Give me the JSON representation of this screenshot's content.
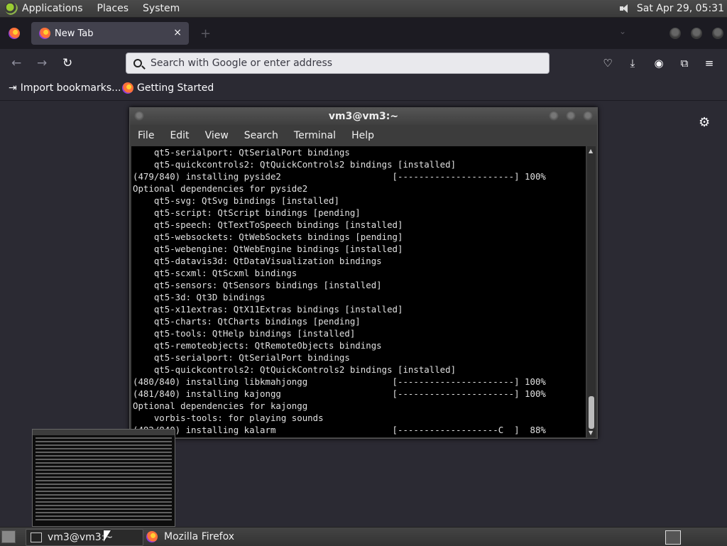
{
  "top_panel": {
    "menus": [
      "Applications",
      "Places",
      "System"
    ],
    "clock": "Sat Apr 29, 05:31"
  },
  "firefox": {
    "tab_title": "New Tab",
    "tab_close": "×",
    "new_tab": "+",
    "url_placeholder": "Search with Google or enter address",
    "bookmarks": [
      "Import bookmarks...",
      "Getting Started"
    ]
  },
  "terminal": {
    "title": "vm3@vm3:~",
    "menu": [
      "File",
      "Edit",
      "View",
      "Search",
      "Terminal",
      "Help"
    ],
    "lines": [
      "    qt5-serialport: QtSerialPort bindings",
      "    qt5-quickcontrols2: QtQuickControls2 bindings [installed]",
      "(479/840) installing pyside2                     [----------------------] 100%",
      "Optional dependencies for pyside2",
      "    qt5-svg: QtSvg bindings [installed]",
      "    qt5-script: QtScript bindings [pending]",
      "    qt5-speech: QtTextToSpeech bindings [installed]",
      "    qt5-websockets: QtWebSockets bindings [pending]",
      "    qt5-webengine: QtWebEngine bindings [installed]",
      "    qt5-datavis3d: QtDataVisualization bindings",
      "    qt5-scxml: QtScxml bindings",
      "    qt5-sensors: QtSensors bindings [installed]",
      "    qt5-3d: Qt3D bindings",
      "    qt5-x11extras: QtX11Extras bindings [installed]",
      "    qt5-charts: QtCharts bindings [pending]",
      "    qt5-tools: QtHelp bindings [installed]",
      "    qt5-remoteobjects: QtRemoteObjects bindings",
      "    qt5-serialport: QtSerialPort bindings",
      "    qt5-quickcontrols2: QtQuickControls2 bindings [installed]",
      "(480/840) installing libkmahjongg                [----------------------] 100%",
      "(481/840) installing kajongg                     [----------------------] 100%",
      "Optional dependencies for kajongg",
      "    vorbis-tools: for playing sounds",
      "(482/840) installing kalarm                      [-------------------C  ]  88%"
    ]
  },
  "taskbar": {
    "items": [
      "vm3@vm3:~",
      "Mozilla Firefox"
    ]
  },
  "colors": {
    "terminal_bg": "#000000",
    "firefox_bg": "#2b2a33"
  }
}
